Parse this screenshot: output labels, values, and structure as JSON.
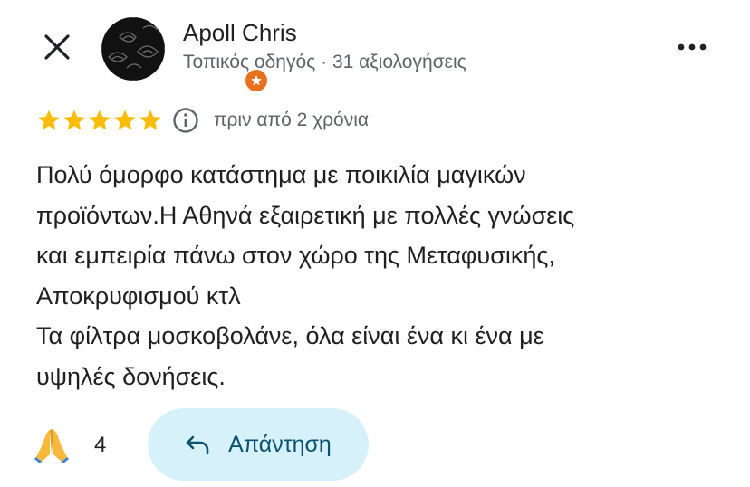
{
  "header": {
    "author_name": "Apoll Chris",
    "author_meta": "Τοπικός οδηγός · 31 αξιολογήσεις",
    "close_icon": "close-icon",
    "more_icon": "more-horizontal-icon",
    "badge_icon": "local-guide-star-icon",
    "badge_color": "#e8711f"
  },
  "review": {
    "rating": 5,
    "rating_max": 5,
    "star_color": "#fbbc04",
    "time": "πριν από 2 χρόνια",
    "text": "Πολύ όμορφο κατάστημα με ποικιλία μαγικών\nπροϊόντων.Η Αθηνά εξαιρετική με πολλές γνώσεις\nκαι εμπειρία πάνω στον χώρο της Μεταφυσικής,\nΑποκρυφισμού κτλ\nΤα φίλτρα μοσκοβολάνε, όλα είναι ένα κι ένα με\nυψηλές δονήσεις."
  },
  "actions": {
    "reaction_emoji": "folded-hands",
    "reaction_count": "4",
    "reply_label": "Απάντηση",
    "reply_bg": "#d7f1fa"
  }
}
